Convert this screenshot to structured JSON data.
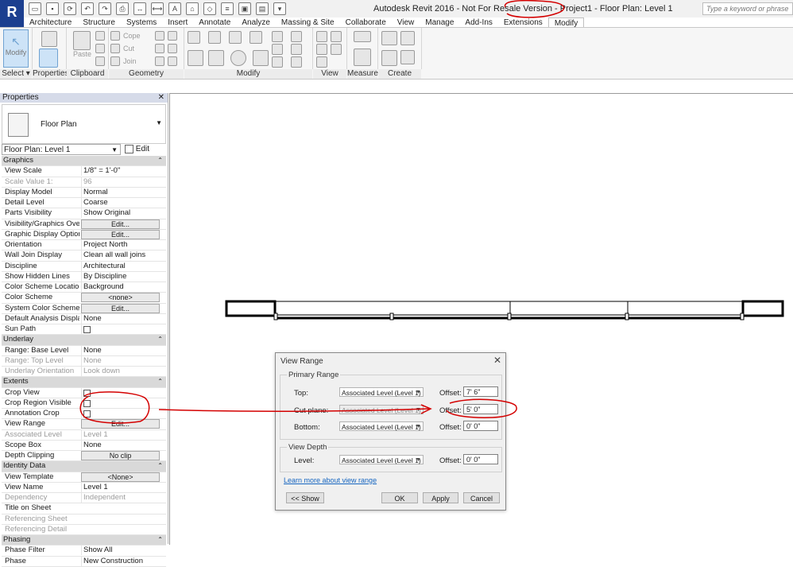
{
  "title_bar": {
    "window_title": "Autodesk Revit 2016 - Not For Resale Version - Project1 - Floor Plan: Level 1",
    "search_placeholder": "Type a keyword or phrase",
    "app_logo": "R"
  },
  "ribbon": {
    "tabs": [
      "Architecture",
      "Structure",
      "Systems",
      "Insert",
      "Annotate",
      "Analyze",
      "Massing & Site",
      "Collaborate",
      "View",
      "Manage",
      "Add-Ins",
      "Extensions",
      "Modify"
    ],
    "active_tab": "Modify",
    "modify_label": "Modify",
    "paste_label": "Paste",
    "cope_label": "Cope",
    "cut_label": "Cut",
    "join_label": "Join",
    "panels": {
      "select": "Select",
      "properties": "Properties",
      "clipboard": "Clipboard",
      "geometry": "Geometry",
      "modify": "Modify",
      "view": "View",
      "measure": "Measure",
      "create": "Create"
    }
  },
  "properties": {
    "header": "Properties",
    "type_name": "Floor Plan",
    "instance_selector": "Floor Plan: Level 1",
    "edit_type": "Edit Type",
    "rows": [
      {
        "kind": "cat",
        "label": "Graphics"
      },
      {
        "label": "View Scale",
        "value": "1/8\" = 1'-0\""
      },
      {
        "label": "Scale Value    1:",
        "value": "96",
        "disabled": true
      },
      {
        "label": "Display Model",
        "value": "Normal"
      },
      {
        "label": "Detail Level",
        "value": "Coarse"
      },
      {
        "label": "Parts Visibility",
        "value": "Show Original"
      },
      {
        "label": "Visibility/Graphics Overr...",
        "button": "Edit..."
      },
      {
        "label": "Graphic Display Options",
        "button": "Edit..."
      },
      {
        "label": "Orientation",
        "value": "Project North"
      },
      {
        "label": "Wall Join Display",
        "value": "Clean all wall joins"
      },
      {
        "label": "Discipline",
        "value": "Architectural"
      },
      {
        "label": "Show Hidden Lines",
        "value": "By Discipline"
      },
      {
        "label": "Color Scheme Location",
        "value": "Background"
      },
      {
        "label": "Color Scheme",
        "button": "<none>"
      },
      {
        "label": "System Color Schemes",
        "button": "Edit..."
      },
      {
        "label": "Default Analysis Display ...",
        "value": "None"
      },
      {
        "label": "Sun Path",
        "check": true
      },
      {
        "kind": "cat",
        "label": "Underlay"
      },
      {
        "label": "Range: Base Level",
        "value": "None"
      },
      {
        "label": "Range: Top Level",
        "value": "None",
        "disabled": true
      },
      {
        "label": "Underlay Orientation",
        "value": "Look down",
        "disabled": true
      },
      {
        "kind": "cat",
        "label": "Extents"
      },
      {
        "label": "Crop View",
        "check": true
      },
      {
        "label": "Crop Region Visible",
        "check": true
      },
      {
        "label": "Annotation Crop",
        "check": true
      },
      {
        "label": "View Range",
        "button": "Edit..."
      },
      {
        "label": "Associated Level",
        "value": "Level 1",
        "disabled": true
      },
      {
        "label": "Scope Box",
        "value": "None"
      },
      {
        "label": "Depth Clipping",
        "button": "No clip"
      },
      {
        "kind": "cat",
        "label": "Identity Data"
      },
      {
        "label": "View Template",
        "button": "<None>"
      },
      {
        "label": "View Name",
        "value": "Level 1"
      },
      {
        "label": "Dependency",
        "value": "Independent",
        "disabled": true
      },
      {
        "label": "Title on Sheet",
        "value": ""
      },
      {
        "label": "Referencing Sheet",
        "value": "",
        "disabled": true
      },
      {
        "label": "Referencing Detail",
        "value": "",
        "disabled": true
      },
      {
        "kind": "cat",
        "label": "Phasing"
      },
      {
        "label": "Phase Filter",
        "value": "Show All"
      },
      {
        "label": "Phase",
        "value": "New Construction"
      }
    ]
  },
  "dialog": {
    "title": "View Range",
    "primary_range_label": "Primary Range",
    "top_label": "Top:",
    "top_level": "Associated Level (Level 1)",
    "top_offset": "7' 6\"",
    "cut_label": "Cut plane:",
    "cut_level": "Associated Level (Level 1)",
    "cut_offset": "5' 0\"",
    "bottom_label": "Bottom:",
    "bottom_level": "Associated Level (Level 1)",
    "bottom_offset": "0' 0\"",
    "offset_label": "Offset:",
    "view_depth_label": "View Depth",
    "level_label": "Level:",
    "depth_level": "Associated Level (Level 1)",
    "depth_offset": "0' 0\"",
    "learn_more": "Learn more about view range",
    "show_button": "<< Show",
    "ok_button": "OK",
    "apply_button": "Apply",
    "cancel_button": "Cancel"
  },
  "colors": {
    "accent_blue": "#1c3f8f",
    "annotation_red": "#d40000",
    "link_blue": "#1565c0"
  }
}
